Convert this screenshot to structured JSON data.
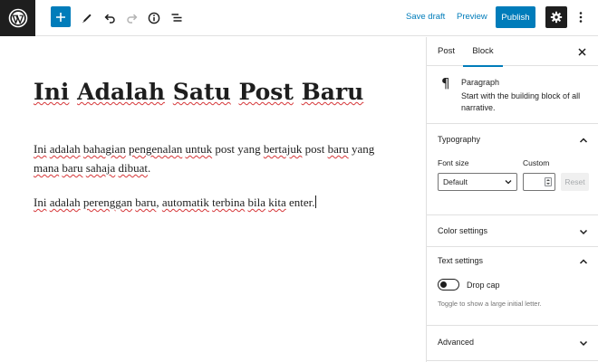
{
  "toolbar": {
    "add_icon": "plus-icon",
    "tools_icon": "pencil-icon",
    "undo_icon": "undo-icon",
    "redo_icon": "redo-icon",
    "info_icon": "info-icon",
    "outline_icon": "list-view-icon",
    "save_draft": "Save draft",
    "preview": "Preview",
    "publish": "Publish",
    "settings_icon": "gear-icon",
    "more_icon": "more-vertical-icon",
    "accent": "#007cba"
  },
  "editor": {
    "title": "Ini Adalah Satu Post Baru",
    "paragraph1": [
      {
        "t": "Ini",
        "s": true
      },
      {
        "t": " ",
        "s": false
      },
      {
        "t": "adalah",
        "s": true
      },
      {
        "t": " ",
        "s": false
      },
      {
        "t": "bahagian",
        "s": true
      },
      {
        "t": " ",
        "s": false
      },
      {
        "t": "pengenalan",
        "s": true
      },
      {
        "t": " ",
        "s": false
      },
      {
        "t": "untuk",
        "s": true
      },
      {
        "t": " post yang ",
        "s": false
      },
      {
        "t": "bertajuk",
        "s": true
      },
      {
        "t": " post ",
        "s": false
      },
      {
        "t": "baru",
        "s": true
      },
      {
        "t": " yang ",
        "s": false
      },
      {
        "t": "mana",
        "s": true
      },
      {
        "t": " ",
        "s": false
      },
      {
        "t": "baru",
        "s": true
      },
      {
        "t": " ",
        "s": false
      },
      {
        "t": "sahaja",
        "s": true
      },
      {
        "t": " ",
        "s": false
      },
      {
        "t": "dibuat",
        "s": true
      },
      {
        "t": ".",
        "s": false
      }
    ],
    "paragraph2": [
      {
        "t": "Ini",
        "s": true
      },
      {
        "t": " ",
        "s": false
      },
      {
        "t": "adalah",
        "s": true
      },
      {
        "t": " ",
        "s": false
      },
      {
        "t": "perenggan",
        "s": true
      },
      {
        "t": " ",
        "s": false
      },
      {
        "t": "baru",
        "s": true
      },
      {
        "t": ", ",
        "s": false
      },
      {
        "t": "automatik",
        "s": true
      },
      {
        "t": " ",
        "s": false
      },
      {
        "t": "terbina",
        "s": true
      },
      {
        "t": " ",
        "s": false
      },
      {
        "t": "bila",
        "s": true
      },
      {
        "t": " ",
        "s": false
      },
      {
        "t": "kita",
        "s": true
      },
      {
        "t": " enter.",
        "s": false
      }
    ]
  },
  "sidebar": {
    "tabs": [
      {
        "label": "Post",
        "active": false
      },
      {
        "label": "Block",
        "active": true
      }
    ],
    "close_icon": "close-icon",
    "block": {
      "icon": "paragraph-icon",
      "name": "Paragraph",
      "description": "Start with the building block of all narrative."
    },
    "typography": {
      "title": "Typography",
      "font_size_label": "Font size",
      "custom_label": "Custom",
      "font_size_value": "Default",
      "custom_value": "",
      "reset_label": "Reset"
    },
    "color_settings": {
      "title": "Color settings"
    },
    "text_settings": {
      "title": "Text settings",
      "drop_cap_label": "Drop cap",
      "drop_cap_enabled": false,
      "help": "Toggle to show a large initial letter."
    },
    "advanced": {
      "title": "Advanced"
    }
  }
}
